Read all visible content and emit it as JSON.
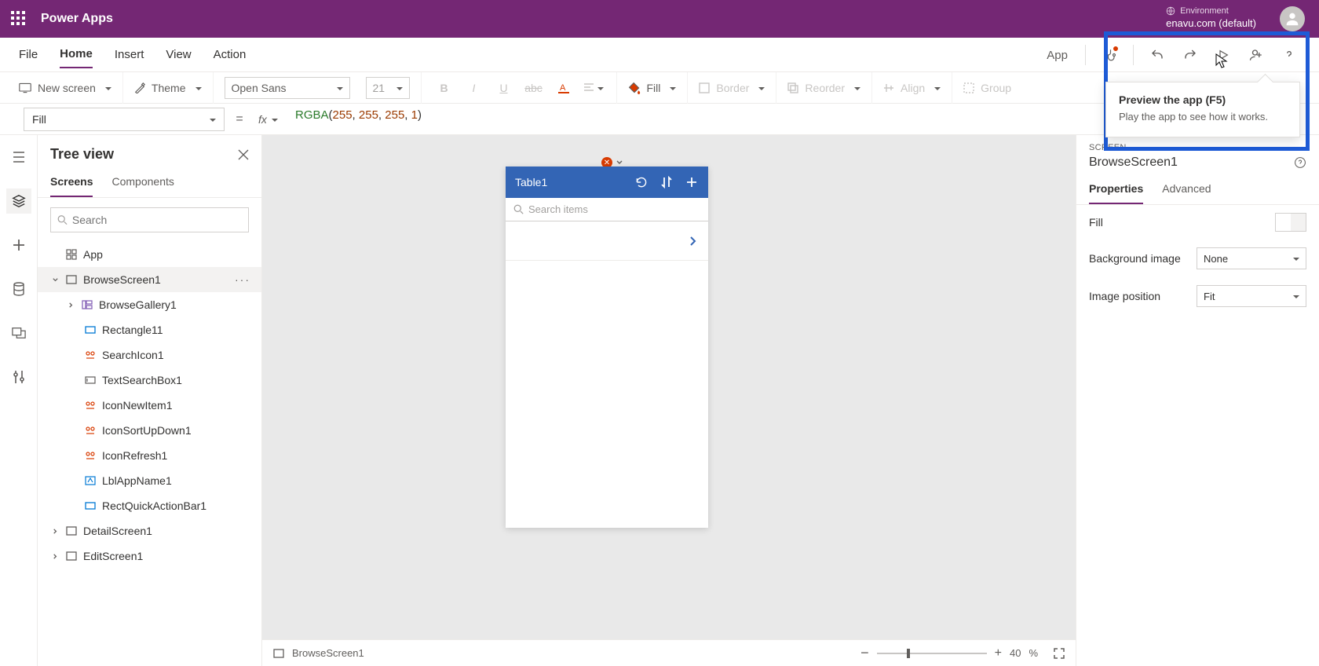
{
  "header": {
    "brand": "Power Apps",
    "env_label": "Environment",
    "env_value": "enavu.com (default)"
  },
  "menu": {
    "file": "File",
    "home": "Home",
    "insert": "Insert",
    "view": "View",
    "action": "Action",
    "app": "App"
  },
  "tooltip": {
    "title": "Preview the app (F5)",
    "body": "Play the app to see how it works."
  },
  "ribbon": {
    "new_screen": "New screen",
    "theme": "Theme",
    "font": "Open Sans",
    "font_size": "21",
    "fill": "Fill",
    "border": "Border",
    "reorder": "Reorder",
    "align": "Align",
    "group": "Group"
  },
  "formula": {
    "property": "Fill",
    "fn": "RGBA",
    "args": [
      "255",
      "255",
      "255",
      "1"
    ]
  },
  "tree": {
    "title": "Tree view",
    "tab_screens": "Screens",
    "tab_components": "Components",
    "search_placeholder": "Search",
    "nodes": {
      "app": "App",
      "browse": "BrowseScreen1",
      "gallery": "BrowseGallery1",
      "rect11": "Rectangle11",
      "searchicon": "SearchIcon1",
      "textsearch": "TextSearchBox1",
      "iconnew": "IconNewItem1",
      "iconsort": "IconSortUpDown1",
      "iconrefresh": "IconRefresh1",
      "lblapp": "LblAppName1",
      "rectquick": "RectQuickActionBar1",
      "detail": "DetailScreen1",
      "edit": "EditScreen1"
    }
  },
  "phone": {
    "title": "Table1",
    "search_placeholder": "Search items"
  },
  "props": {
    "section": "SCREEN",
    "title": "BrowseScreen1",
    "tab_props": "Properties",
    "tab_adv": "Advanced",
    "fill_label": "Fill",
    "bg_label": "Background image",
    "bg_value": "None",
    "imgpos_label": "Image position",
    "imgpos_value": "Fit"
  },
  "status": {
    "screen": "BrowseScreen1",
    "zoom": "40",
    "pct": "%"
  }
}
